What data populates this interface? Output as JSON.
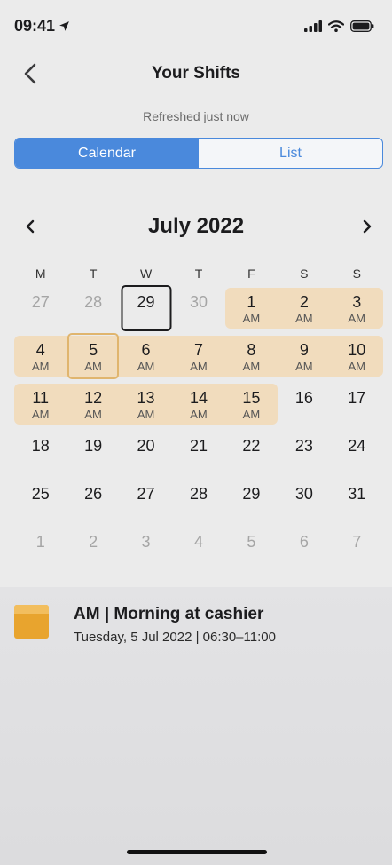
{
  "status": {
    "time": "09:41"
  },
  "header": {
    "title": "Your Shifts"
  },
  "refresh": "Refreshed just now",
  "tabs": [
    {
      "label": "Calendar",
      "active": true
    },
    {
      "label": "List",
      "active": false
    }
  ],
  "calendar": {
    "month_label": "July 2022",
    "weekdays": [
      "M",
      "T",
      "W",
      "T",
      "F",
      "S",
      "S"
    ],
    "days": [
      {
        "num": "27",
        "muted": true
      },
      {
        "num": "28",
        "muted": true
      },
      {
        "num": "29",
        "today": true
      },
      {
        "num": "30",
        "muted": true
      },
      {
        "num": "1",
        "tag": "AM"
      },
      {
        "num": "2",
        "tag": "AM"
      },
      {
        "num": "3",
        "tag": "AM"
      },
      {
        "num": "4",
        "tag": "AM"
      },
      {
        "num": "5",
        "tag": "AM",
        "selected": true
      },
      {
        "num": "6",
        "tag": "AM"
      },
      {
        "num": "7",
        "tag": "AM"
      },
      {
        "num": "8",
        "tag": "AM"
      },
      {
        "num": "9",
        "tag": "AM"
      },
      {
        "num": "10",
        "tag": "AM"
      },
      {
        "num": "11",
        "tag": "AM"
      },
      {
        "num": "12",
        "tag": "AM"
      },
      {
        "num": "13",
        "tag": "AM"
      },
      {
        "num": "14",
        "tag": "AM"
      },
      {
        "num": "15",
        "tag": "AM"
      },
      {
        "num": "16"
      },
      {
        "num": "17"
      },
      {
        "num": "18"
      },
      {
        "num": "19"
      },
      {
        "num": "20"
      },
      {
        "num": "21"
      },
      {
        "num": "22"
      },
      {
        "num": "23"
      },
      {
        "num": "24"
      },
      {
        "num": "25"
      },
      {
        "num": "26"
      },
      {
        "num": "27"
      },
      {
        "num": "28"
      },
      {
        "num": "29"
      },
      {
        "num": "30"
      },
      {
        "num": "31"
      },
      {
        "num": "1",
        "muted": true
      },
      {
        "num": "2",
        "muted": true
      },
      {
        "num": "3",
        "muted": true
      },
      {
        "num": "4",
        "muted": true
      },
      {
        "num": "5",
        "muted": true
      },
      {
        "num": "6",
        "muted": true
      },
      {
        "num": "7",
        "muted": true
      }
    ]
  },
  "shift_detail": {
    "title": "AM | Morning at cashier",
    "subtitle": "Tuesday, 5 Jul 2022 | 06:30–11:00",
    "color": "#E8A42E"
  },
  "colors": {
    "accent": "#4A89DC",
    "shift_band": "#F1DCBD",
    "selected_border": "#E0B56E"
  }
}
